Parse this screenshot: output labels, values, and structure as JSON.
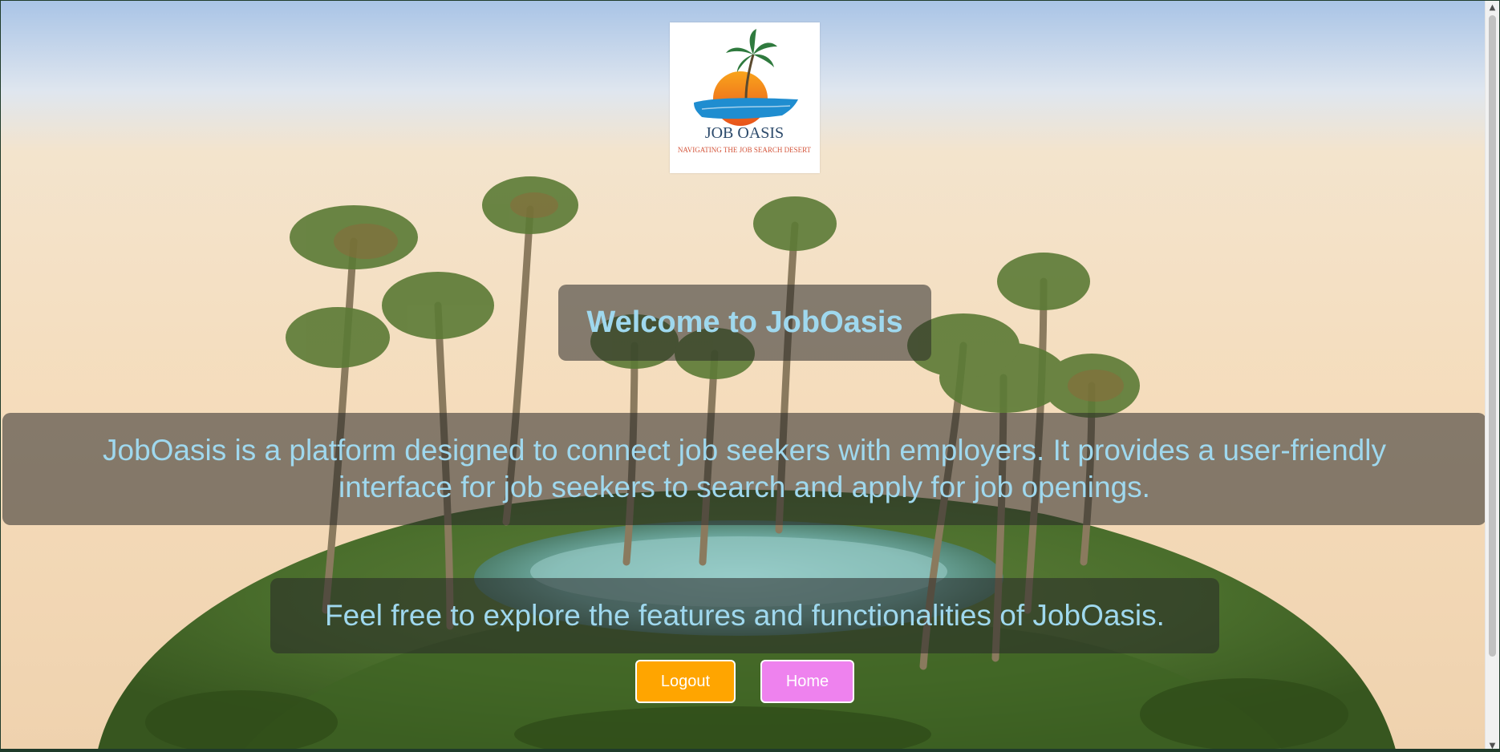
{
  "brand": {
    "logo_title": "JOB OASIS",
    "logo_tagline": "NAVIGATING THE JOB SEARCH DESERT"
  },
  "main": {
    "welcome": "Welcome to JobOasis",
    "description": "JobOasis is a platform designed to connect job seekers with employers. It provides a user-friendly interface for job seekers to search and apply for job openings.",
    "explore": "Feel free to explore the features and functionalities of JobOasis."
  },
  "actions": {
    "logout_label": "Logout",
    "home_label": "Home"
  },
  "colors": {
    "text_accent": "#9fd8ee",
    "logout_bg": "#ffa500",
    "home_bg": "#ee82ee",
    "panel_bg": "rgba(40,40,40,0.55)"
  },
  "icons": {
    "scroll_up": "▲",
    "scroll_down": "▼"
  }
}
